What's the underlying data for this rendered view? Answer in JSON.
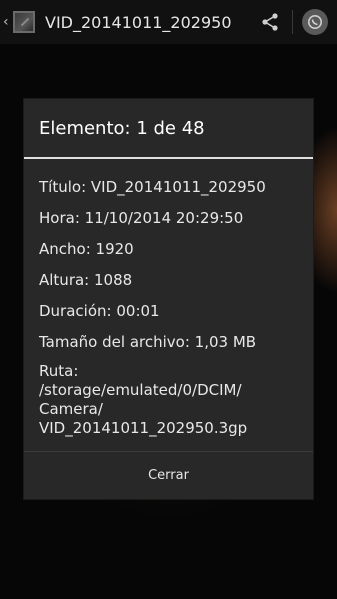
{
  "actionbar": {
    "title": "VID_20141011_202950",
    "share_icon": "share-icon",
    "whatsapp_icon": "whatsapp-icon"
  },
  "dialog": {
    "title": "Elemento: 1 de 48",
    "details": [
      {
        "label": "Título:",
        "value": "VID_20141011_202950"
      },
      {
        "label": "Hora:",
        "value": "11/10/2014 20:29:50"
      },
      {
        "label": "Ancho:",
        "value": "1920"
      },
      {
        "label": "Altura:",
        "value": "1088"
      },
      {
        "label": "Duración:",
        "value": "00:01"
      },
      {
        "label": "Tamaño del archivo:",
        "value": "1,03 MB"
      }
    ],
    "path_label": "Ruta:",
    "path_lines": [
      "/storage/emulated/0/DCIM/",
      "Camera/",
      "VID_20141011_202950.3gp"
    ],
    "close_label": "Cerrar"
  },
  "colors": {
    "dialog_bg": "#282828",
    "divider": "#e0e0e0",
    "text": "#e8e8e8"
  }
}
